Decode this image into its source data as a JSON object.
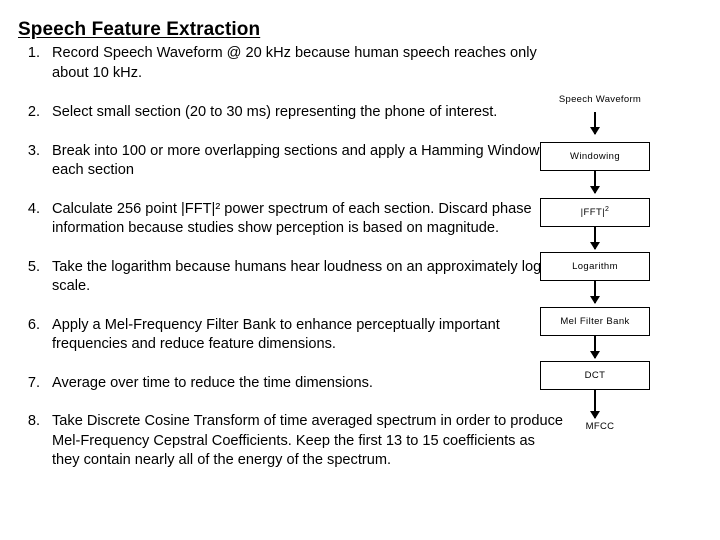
{
  "slide": {
    "title": "Speech Feature Extraction",
    "background_color": "#ffffff",
    "text_color": "#000000"
  },
  "steps": [
    {
      "number": "1.",
      "text": "Record Speech Waveform @ 20 kHz because human speech reaches only about 10 kHz."
    },
    {
      "number": "2.",
      "text": "Select small section (20 to 30 ms) representing the phone of interest."
    },
    {
      "number": "3.",
      "text": "Break into 100 or more overlapping sections and apply a Hamming Window to each section"
    },
    {
      "number": "4.",
      "text": "Calculate 256 point |FFT|² power spectrum of each section.  Discard phase information because studies show perception is based on magnitude."
    },
    {
      "number": "5.",
      "text": "Take the logarithm because humans hear loudness on an approximately log scale."
    },
    {
      "number": "6.",
      "text": "Apply a Mel-Frequency Filter Bank to enhance perceptually important frequencies and reduce feature dimensions."
    },
    {
      "number": "7.",
      "text": "Average over time to reduce the time dimensions."
    },
    {
      "number": "8.",
      "text": "Take Discrete Cosine Transform of time averaged spectrum in order to produce Mel-Frequency Cepstral Coefficients.  Keep the first 13 to 15 coefficients as they contain nearly all of the energy of the spectrum."
    }
  ],
  "flowchart": {
    "input_label": "Speech Waveform",
    "output_label": "MFCC",
    "boxes": [
      {
        "label": "Windowing"
      },
      {
        "label_html_base": "|FFT|",
        "label_sup": "2",
        "label": "|FFT|²"
      },
      {
        "label": "Logarithm"
      },
      {
        "label": "Mel Filter Bank"
      },
      {
        "label": "DCT"
      }
    ]
  }
}
